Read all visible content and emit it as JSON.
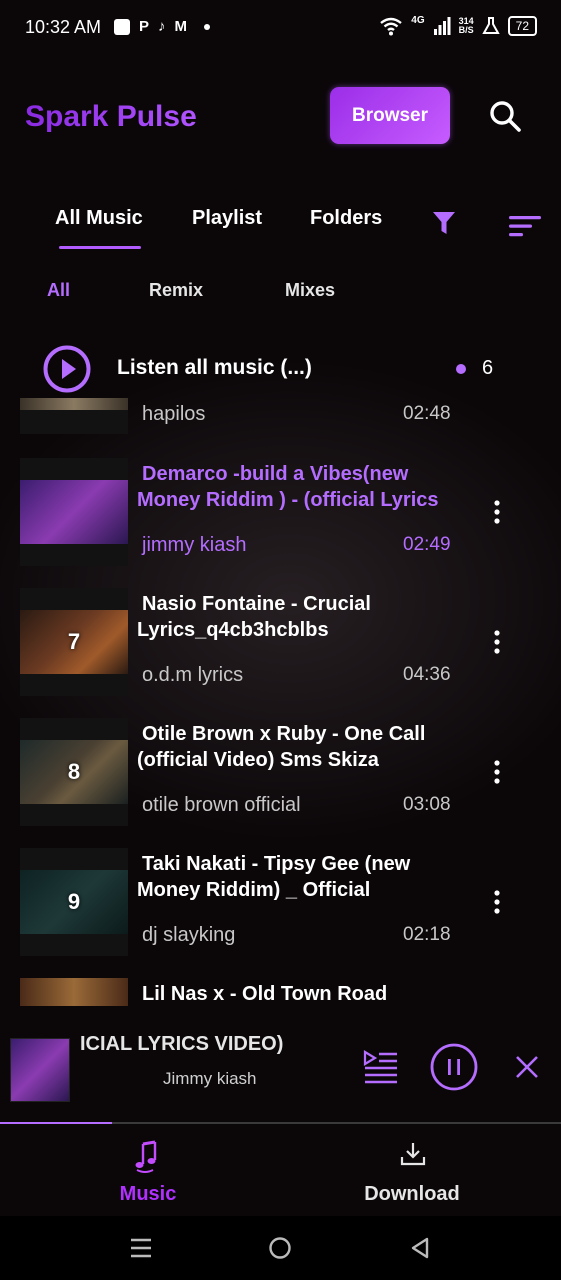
{
  "status_bar": {
    "time": "10:32 AM",
    "left_icons": [
      "notification-square-icon",
      "p-icon",
      "tiktok-icon",
      "gmail-icon",
      "dot-icon"
    ],
    "network_type": "4G",
    "speed_value": "314",
    "speed_unit": "B/S",
    "battery": "72"
  },
  "header": {
    "app_title": "Spark Pulse",
    "browser_button": "Browser",
    "brand_gradient": [
      "#8a2be2",
      "#b054ff"
    ]
  },
  "tabs": [
    {
      "label": "All Music",
      "active": true
    },
    {
      "label": "Playlist",
      "active": false
    },
    {
      "label": "Folders",
      "active": false
    }
  ],
  "chips": [
    {
      "label": "All",
      "active": true
    },
    {
      "label": "Remix",
      "active": false
    },
    {
      "label": "Mixes",
      "active": false
    }
  ],
  "listen_all": {
    "label": "Listen all music (...)",
    "count": "6"
  },
  "songs": [
    {
      "number": "",
      "title_line1": "",
      "title_line2": "",
      "artist": "hapilos",
      "duration": "02:48",
      "playing": false
    },
    {
      "number": "",
      "title_line1": "Demarco -build a Vibes(new",
      "title_line2": "Money Riddim ) - (official Lyrics",
      "artist": "jimmy kiash",
      "duration": "02:49",
      "playing": true
    },
    {
      "number": "7",
      "title_line1": "Nasio Fontaine - Crucial",
      "title_line2": "Lyrics_q4cb3hcblbs",
      "artist": "o.d.m lyrics",
      "duration": "04:36",
      "playing": false
    },
    {
      "number": "8",
      "title_line1": "Otile Brown x Ruby - One Call",
      "title_line2": "(official Video) Sms Skiza",
      "artist": "otile brown official",
      "duration": "03:08",
      "playing": false
    },
    {
      "number": "9",
      "title_line1": "Taki Nakati - Tipsy Gee (new",
      "title_line2": "Money Riddim) _ Official",
      "artist": "dj slayking",
      "duration": "02:18",
      "playing": false
    },
    {
      "number": "",
      "title_line1": "Lil Nas x - Old Town Road",
      "title_line2": "",
      "artist": "",
      "duration": "",
      "playing": false
    }
  ],
  "mini_player": {
    "title": "ICIAL LYRICS VIDEO)",
    "artist": "Jimmy kiash",
    "progress": 0.2
  },
  "bottom_nav": {
    "music_label": "Music",
    "download_label": "Download"
  },
  "colors": {
    "accent": "#b46dff",
    "accent_strong": "#b030ff",
    "background": "#0b0709"
  }
}
